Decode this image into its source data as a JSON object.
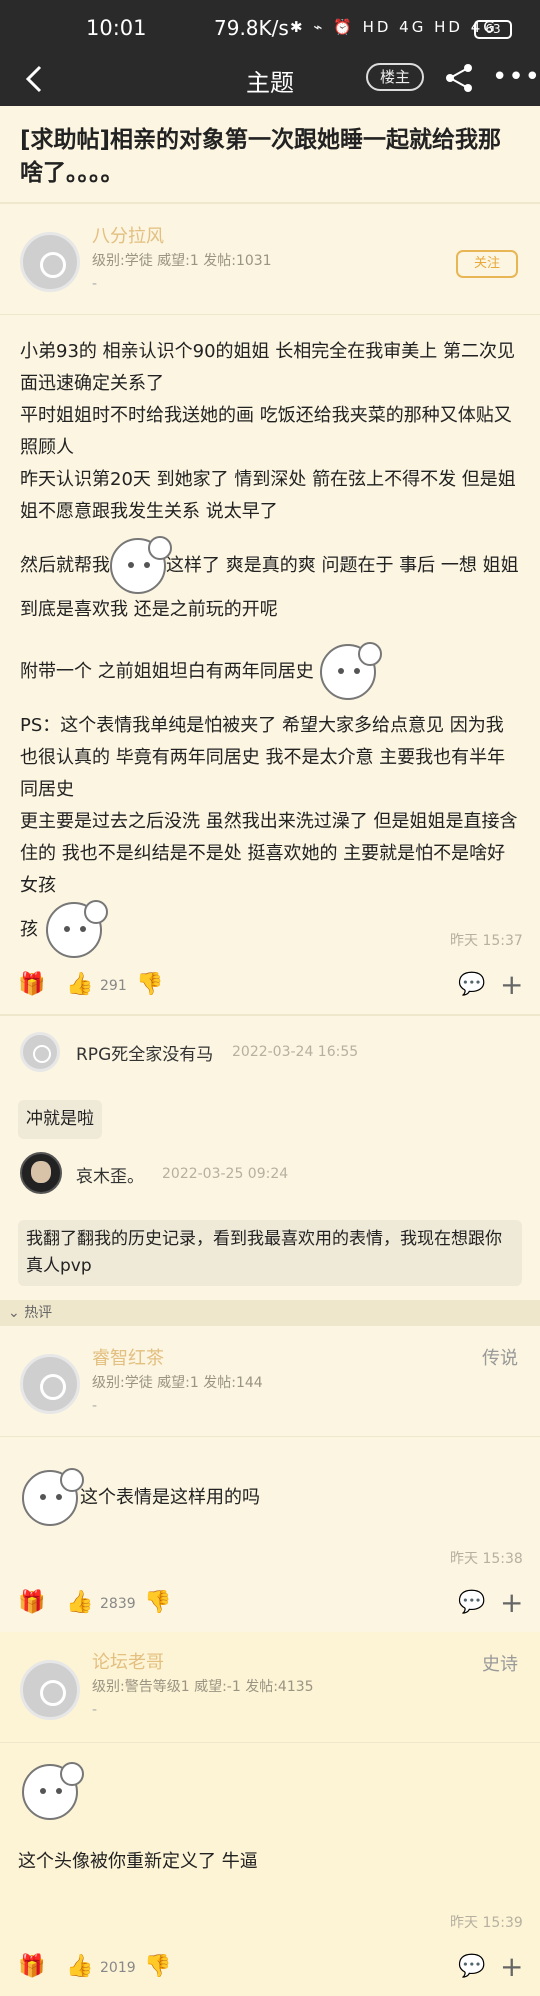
{
  "status_bar": {
    "time": "10:01",
    "speed": "79.8K/s",
    "icons": "✱ ⌁ ⏰ HD 4G HD 4G",
    "battery": "63"
  },
  "nav": {
    "back_icon": "chevron-left-icon",
    "title": "主题",
    "op_label": "楼主",
    "share_icon": "share-icon",
    "more": "•••"
  },
  "thread": {
    "title": "[求助帖]相亲的对象第一次跟她睡一起就给我那啥了。。。。"
  },
  "post": {
    "author": "八分拉风",
    "meta": "级别:学徒 威望:1 发帖:1031",
    "dash": "-",
    "follow": "关注",
    "lines": [
      "小弟93的 相亲认识个90的姐姐 长相完全在我审美上 第二次见面迅速确定关系了",
      "平时姐姐时不时给我送她的画 吃饭还给我夹菜的那种又体贴又照顾人",
      "昨天认识第20天 到她家了 情到深处 箭在弦上不得不发 但是姐姐不愿意跟我发生关系 说太早了"
    ],
    "line4_a": "然后就帮我",
    "line4_b": "这样了 爽是真的爽 问题在于 事后 一想 姐姐到底是喜欢我 还是之前玩的开呢",
    "line5": "附带一个 之前姐姐坦白有两年同居史",
    "line6": "PS：这个表情我单纯是怕被夹了 希望大家多给点意见 因为我也很认真的 毕竟有两年同居史 我不是太介意 主要我也有半年同居史",
    "line7": "更主要是过去之后没洗 虽然我出来洗过澡了 但是姐姐是直接含住的 我也不是纠结是不是处 挺喜欢她的 主要就是怕不是啥好女孩",
    "time": "昨天 15:37",
    "likes": "291"
  },
  "replies": [
    {
      "name": "RPG死全家没有马",
      "time": "2022-03-24 16:55",
      "text": "冲就是啦"
    },
    {
      "name": "哀木歪。",
      "time": "2022-03-25 09:24",
      "text": "我翻了翻我的历史记录，看到我最喜欢用的表情，我现在想跟你真人pvp"
    }
  ],
  "hot_label": "热评",
  "hot": [
    {
      "author": "睿智红茶",
      "rank": "传说",
      "meta": "级别:学徒 威望:1 发帖:144",
      "dash": "-",
      "text": "这个表情是这样用的吗",
      "time": "昨天 15:38",
      "likes": "2839"
    },
    {
      "author": "论坛老哥",
      "rank": "史诗",
      "meta": "级别:警告等级1 威望:-1 发帖:4135",
      "dash": "-",
      "text": "这个头像被你重新定义了 牛逼",
      "time": "昨天 15:39",
      "likes": "2019"
    }
  ],
  "icons": {
    "gift": "gift-icon",
    "like": "thumbs-up-icon",
    "dislike": "thumbs-down-icon",
    "comment": "comment-icon",
    "plus": "plus-icon",
    "sticker": "chibi-sticker-icon"
  }
}
